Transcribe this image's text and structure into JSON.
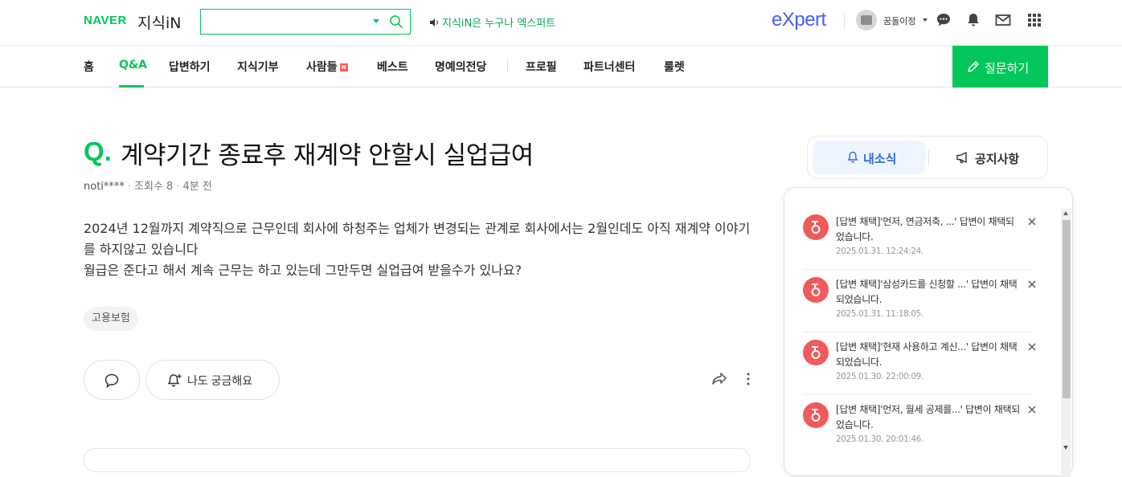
{
  "header": {
    "logo_naver": "NAVER",
    "logo_kin": "지식iN",
    "search_value": "",
    "promo_text": "지식iN은 누구나 엑스퍼트",
    "expert_logo": "eXpert",
    "username": "꿈돌이정",
    "icons": [
      "search-icon",
      "speaker-icon",
      "chat-bubble-icon",
      "bell-icon",
      "mail-icon",
      "grid-menu-icon"
    ]
  },
  "nav": {
    "items": [
      {
        "label": "홈"
      },
      {
        "label": "Q&A",
        "active": true
      },
      {
        "label": "답변하기"
      },
      {
        "label": "지식기부"
      },
      {
        "label": "사람들",
        "badge": "N"
      },
      {
        "label": "베스트"
      },
      {
        "label": "명예의전당"
      },
      {
        "label": "프로필"
      },
      {
        "label": "파트너센터"
      },
      {
        "label": "룰렛"
      }
    ],
    "ask_button": "질문하기"
  },
  "question": {
    "q_mark": "Q.",
    "title": "계약기간 종료후 재계약 안할시 실업급여",
    "author": "noti****",
    "views": "조회수 8",
    "time": "4분 전",
    "body": [
      "2024년 12월까지 계약직으로 근무인데 회사에 하청주는 업체가 변경되는 관계로 회사에서는 2월인데도 아직 재계약 이야기를 하지않고 있습니다",
      "월급은 준다고 해서 계속 근무는 하고 있는데 그만두면 실업급여 받을수가 있나요?"
    ],
    "tag": "고용보험",
    "curious_button": "나도 궁금해요"
  },
  "side_tabs": {
    "news": "내소식",
    "notice": "공지사항"
  },
  "notifications": [
    {
      "text": "[답변 채택]'먼저, 연금저축, ...' 답변이 채택되었습니다.",
      "date": "2025.01.31. 12:24:24."
    },
    {
      "text": "[답변 채택]'삼성카드를 신청할 ...' 답변이 채택되었습니다.",
      "date": "2025.01.31. 11:18:05."
    },
    {
      "text": "[답변 채택]'현재 사용하고 계신...' 답변이 채택되었습니다.",
      "date": "2025.01.30. 22:00:09."
    },
    {
      "text": "[답변 채택]'먼저, 월세 공제를...' 답변이 채택되었습니다.",
      "date": "2025.01.30. 20:01:46."
    }
  ],
  "colors": {
    "brand_green": "#03c75a",
    "expert_blue": "#4b5bf0",
    "notif_red": "#f05a5a",
    "tab_active_bg": "#eef5fe",
    "tab_active_text": "#2f6bd8"
  }
}
